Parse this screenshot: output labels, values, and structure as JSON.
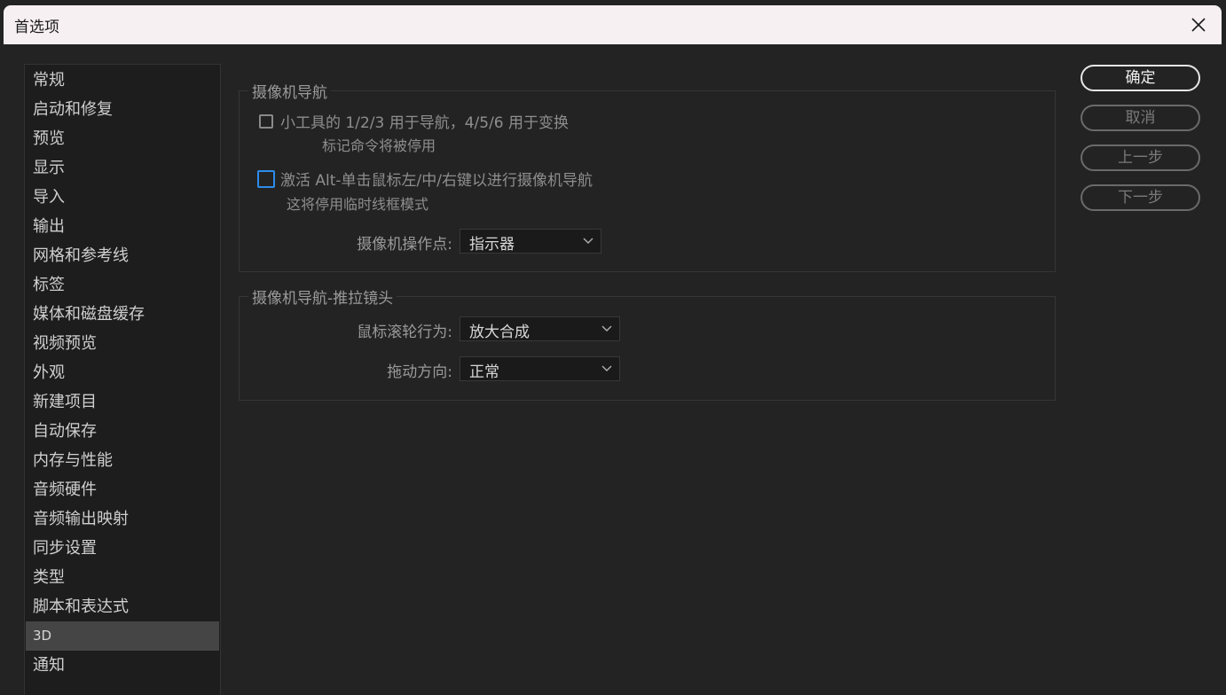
{
  "window": {
    "title": "首选项"
  },
  "sidebar": {
    "items": [
      {
        "label": "常规"
      },
      {
        "label": "启动和修复"
      },
      {
        "label": "预览"
      },
      {
        "label": "显示"
      },
      {
        "label": "导入"
      },
      {
        "label": "输出"
      },
      {
        "label": "网格和参考线"
      },
      {
        "label": "标签"
      },
      {
        "label": "媒体和磁盘缓存"
      },
      {
        "label": "视频预览"
      },
      {
        "label": "外观"
      },
      {
        "label": "新建项目"
      },
      {
        "label": "自动保存"
      },
      {
        "label": "内存与性能"
      },
      {
        "label": "音频硬件"
      },
      {
        "label": "音频输出映射"
      },
      {
        "label": "同步设置"
      },
      {
        "label": "类型"
      },
      {
        "label": "脚本和表达式"
      },
      {
        "label": "3D"
      },
      {
        "label": "通知"
      }
    ],
    "selected": "3D"
  },
  "camera_nav": {
    "title": "摄像机导航",
    "option1_label": "小工具的 1/2/3 用于导航，4/5/6 用于变换",
    "option1_sub": "标记命令将被停用",
    "option1_checked": false,
    "option2_label": "激活 Alt-单击鼠标左/中/右键以进行摄像机导航",
    "option2_sub": "这将停用临时线框模式",
    "option2_checked": false,
    "pivot_label": "摄像机操作点:",
    "pivot_value": "指示器"
  },
  "camera_dolly": {
    "title": "摄像机导航-推拉镜头",
    "wheel_label": "鼠标滚轮行为:",
    "wheel_value": "放大合成",
    "drag_label": "拖动方向:",
    "drag_value": "正常"
  },
  "buttons": {
    "ok": "确定",
    "cancel": "取消",
    "prev": "上一步",
    "next": "下一步"
  }
}
